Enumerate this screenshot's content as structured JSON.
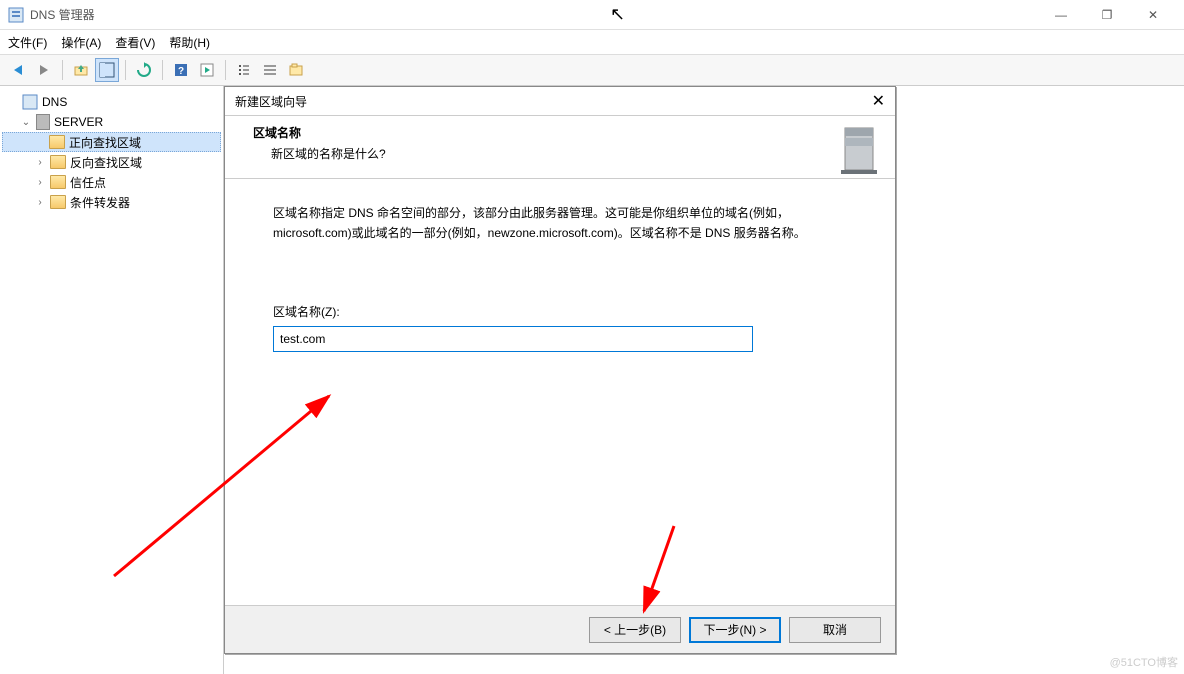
{
  "window": {
    "title": "DNS 管理器",
    "controls": {
      "min": "—",
      "max": "❐",
      "close": "✕"
    }
  },
  "menu": {
    "file": "文件(F)",
    "action": "操作(A)",
    "view": "查看(V)",
    "help": "帮助(H)"
  },
  "tree": {
    "root": "DNS",
    "server": "SERVER",
    "fwd": "正向查找区域",
    "rev": "反向查找区域",
    "trust": "信任点",
    "cond": "条件转发器"
  },
  "dialog": {
    "title": "新建区域向导",
    "heading": "区域名称",
    "subheading": "新区域的名称是什么?",
    "description": "区域名称指定 DNS 命名空间的部分，该部分由此服务器管理。这可能是你组织单位的域名(例如，microsoft.com)或此域名的一部分(例如，newzone.microsoft.com)。区域名称不是 DNS 服务器名称。",
    "input_label": "区域名称(Z):",
    "input_value": "test.com",
    "back": "< 上一步(B)",
    "next": "下一步(N) >",
    "cancel": "取消"
  },
  "watermark": "@51CTO博客"
}
